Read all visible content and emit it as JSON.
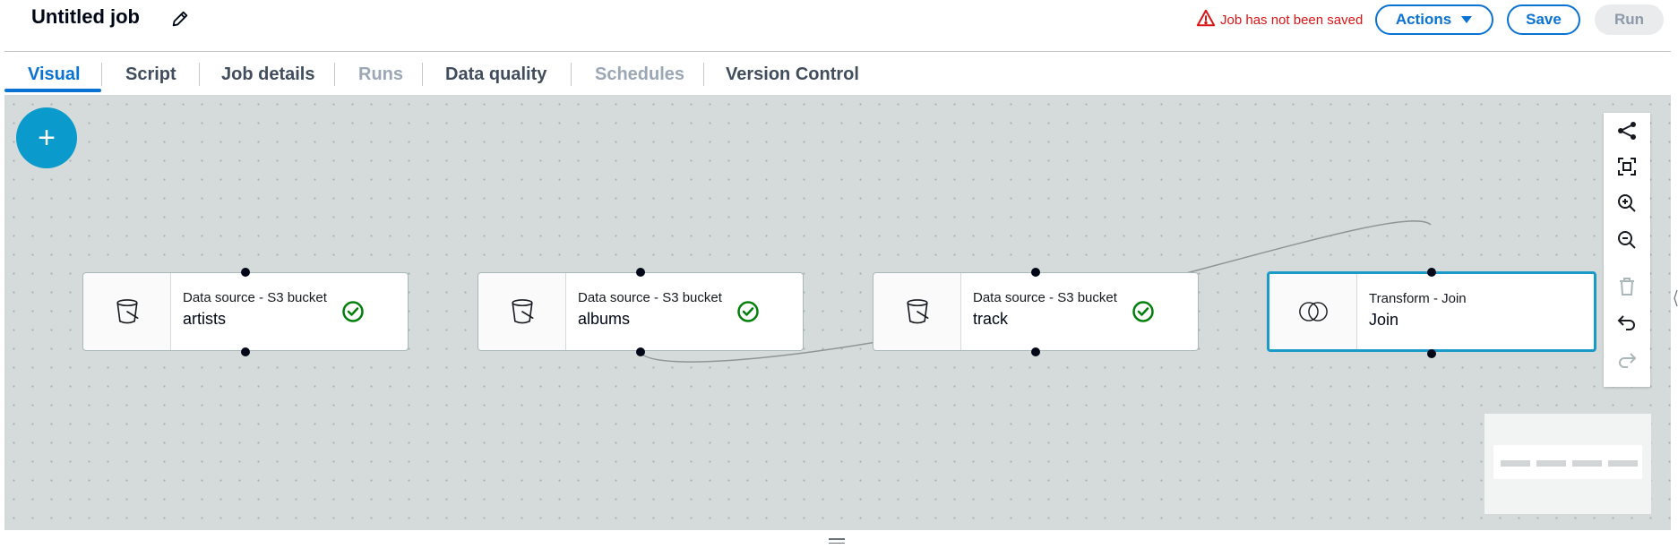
{
  "header": {
    "title": "Untitled job",
    "edit_icon": "pencil-icon",
    "warning_text": "Job has not been saved",
    "warning_icon": "warning-triangle-icon",
    "actions_label": "Actions",
    "save_label": "Save",
    "run_label": "Run"
  },
  "tabs": [
    {
      "label": "Visual",
      "state": "active"
    },
    {
      "label": "Script",
      "state": "enabled"
    },
    {
      "label": "Job details",
      "state": "enabled"
    },
    {
      "label": "Runs",
      "state": "disabled"
    },
    {
      "label": "Data quality",
      "state": "enabled"
    },
    {
      "label": "Schedules",
      "state": "disabled"
    },
    {
      "label": "Version Control",
      "state": "enabled"
    }
  ],
  "canvas": {
    "add_button_label": "+",
    "nodes": [
      {
        "type": "Data source - S3 bucket",
        "name": "artists",
        "icon": "s3-bucket-icon",
        "status": "check-circle-icon"
      },
      {
        "type": "Data source - S3 bucket",
        "name": "albums",
        "icon": "s3-bucket-icon",
        "status": "check-circle-icon"
      },
      {
        "type": "Data source - S3 bucket",
        "name": "track",
        "icon": "s3-bucket-icon",
        "status": "check-circle-icon"
      },
      {
        "type": "Transform - Join",
        "name": "Join",
        "icon": "join-venn-icon",
        "status": ""
      }
    ],
    "toolbar": [
      "layout-graph-icon",
      "fit-view-icon",
      "zoom-in-icon",
      "zoom-out-icon",
      "delete-icon",
      "undo-icon",
      "redo-icon"
    ]
  },
  "colors": {
    "accent": "#0972d3",
    "warning": "#d91515",
    "success": "#037f0c",
    "selected_border": "#1a9ac7",
    "add_button": "#0a9acb"
  }
}
